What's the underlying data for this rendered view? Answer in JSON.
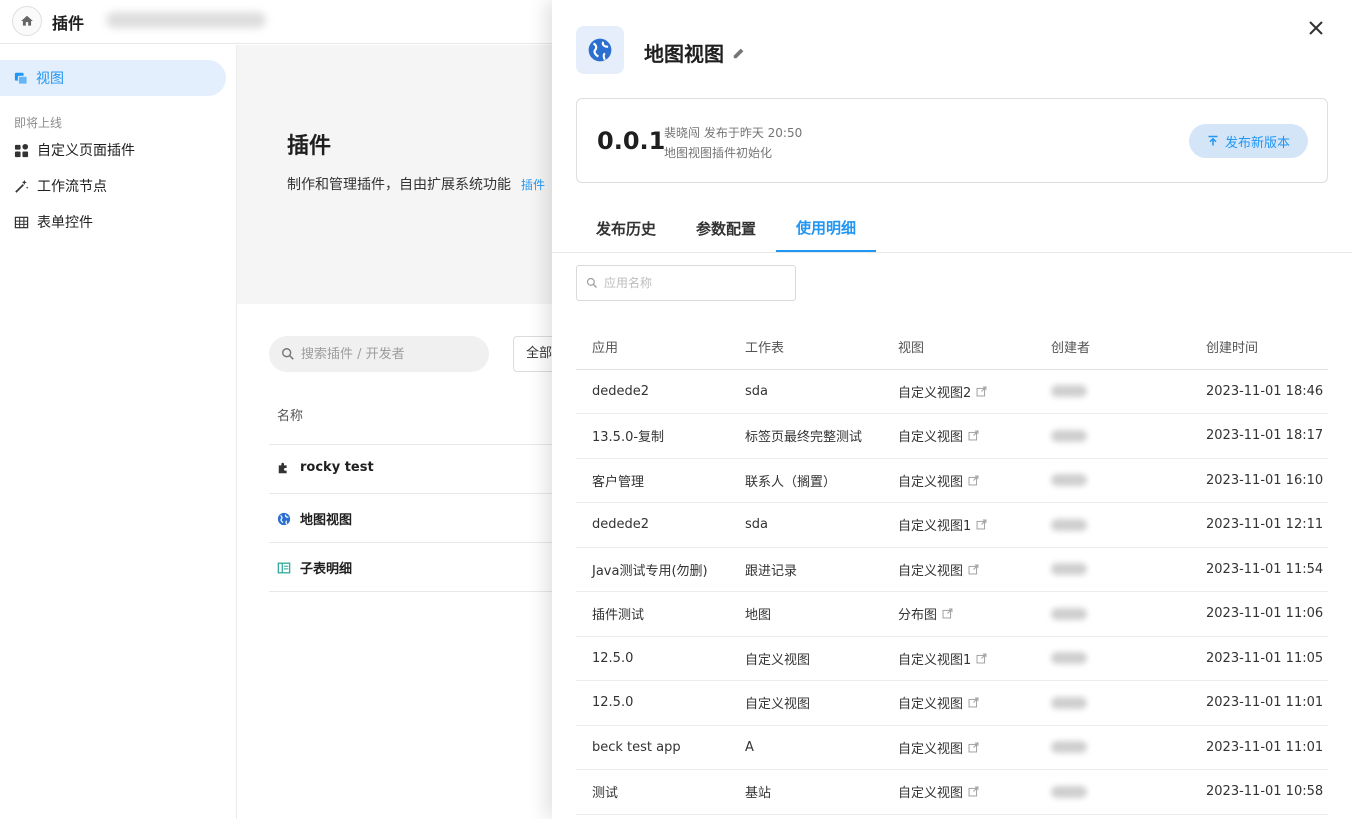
{
  "topbar": {
    "title": "插件"
  },
  "sidebar": {
    "active_item": "视图",
    "group_label": "即将上线",
    "items": [
      {
        "label": "自定义页面插件",
        "icon": "widgets-icon"
      },
      {
        "label": "工作流节点",
        "icon": "magic-wand-icon"
      },
      {
        "label": "表单控件",
        "icon": "table-icon"
      }
    ]
  },
  "main": {
    "title": "插件",
    "description": "制作和管理插件，自由扩展系统功能",
    "link_text": "插件",
    "search_placeholder": "搜索插件 / 开发者",
    "filter_label": "全部",
    "column_name": "名称",
    "plugins": [
      {
        "name": "rocky test"
      },
      {
        "name": "地图视图"
      },
      {
        "name": "子表明细"
      }
    ]
  },
  "drawer": {
    "title": "地图视图",
    "version": {
      "number": "0.0.1",
      "meta": "裴晓闯 发布于昨天 20:50",
      "note": "地图视图插件初始化",
      "publish_button": "发布新版本"
    },
    "tabs": [
      "发布历史",
      "参数配置",
      "使用明细"
    ],
    "active_tab": "使用明细",
    "search_placeholder": "应用名称",
    "table": {
      "headers": [
        "应用",
        "工作表",
        "视图",
        "创建者",
        "创建时间"
      ],
      "rows": [
        {
          "app": "dedede2",
          "sheet": "sda",
          "view": "自定义视图2",
          "created": "2023-11-01 18:46"
        },
        {
          "app": "13.5.0-复制",
          "sheet": "标签页最终完整测试",
          "view": "自定义视图",
          "created": "2023-11-01 18:17"
        },
        {
          "app": "客户管理",
          "sheet": "联系人（搁置）",
          "view": "自定义视图",
          "created": "2023-11-01 16:10"
        },
        {
          "app": "dedede2",
          "sheet": "sda",
          "view": "自定义视图1",
          "created": "2023-11-01 12:11"
        },
        {
          "app": "Java测试专用(勿删)",
          "sheet": "跟进记录",
          "view": "自定义视图",
          "created": "2023-11-01 11:54"
        },
        {
          "app": "插件测试",
          "sheet": "地图",
          "view": "分布图",
          "created": "2023-11-01 11:06"
        },
        {
          "app": "12.5.0",
          "sheet": "自定义视图",
          "view": "自定义视图1",
          "created": "2023-11-01 11:05"
        },
        {
          "app": "12.5.0",
          "sheet": "自定义视图",
          "view": "自定义视图",
          "created": "2023-11-01 11:01"
        },
        {
          "app": "beck test app",
          "sheet": "A",
          "view": "自定义视图",
          "created": "2023-11-01 11:01"
        },
        {
          "app": "测试",
          "sheet": "基站",
          "view": "自定义视图",
          "created": "2023-11-01 10:58"
        }
      ]
    }
  },
  "colors": {
    "accent": "#2196f3",
    "active_bg": "#e3effc",
    "hero_bg": "#f5f5f5"
  }
}
